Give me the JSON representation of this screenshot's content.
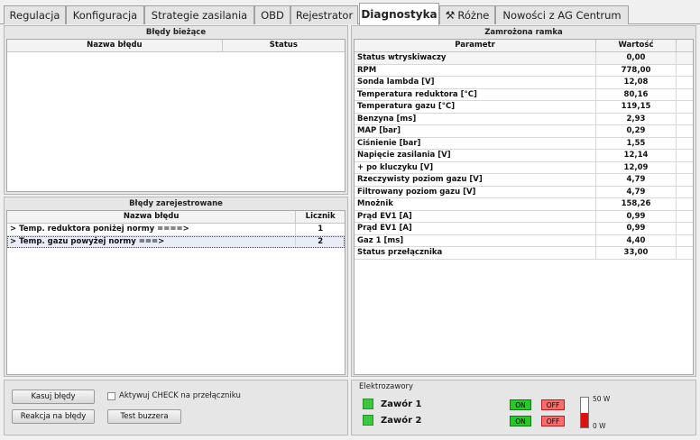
{
  "tabs": [
    {
      "label": "Regulacja"
    },
    {
      "label": "Konfiguracja"
    },
    {
      "label": "Strategie zasilania"
    },
    {
      "label": "OBD"
    },
    {
      "label": "Rejestrator"
    },
    {
      "label": "Diagnostyka",
      "active": true
    },
    {
      "label": "Różne",
      "icon": "tools-icon"
    },
    {
      "label": "Nowości z AG Centrum"
    }
  ],
  "current_errors": {
    "title": "Błędy bieżące",
    "columns": [
      "Nazwa błędu",
      "Status"
    ],
    "rows": []
  },
  "registered_errors": {
    "title": "Błędy zarejestrowane",
    "columns": [
      "Nazwa błędu",
      "Licznik"
    ],
    "rows": [
      {
        "name": "> Temp. reduktora poniżej normy ====>",
        "count": "1"
      },
      {
        "name": "> Temp. gazu powyżej normy ===>",
        "count": "2"
      }
    ]
  },
  "controls": {
    "clear_errors": "Kasuj błędy",
    "error_reaction": "Reakcja na błędy",
    "activate_check": "Aktywuj CHECK na przełączniku",
    "activate_check_checked": false,
    "buzzer_test": "Test buzzera"
  },
  "frozen_frame": {
    "title": "Zamrożona ramka",
    "columns": [
      "Parametr",
      "Wartość"
    ],
    "rows": [
      {
        "param": "Status wtryskiwaczy",
        "value": "0,00"
      },
      {
        "param": "RPM",
        "value": "778,00"
      },
      {
        "param": "Sonda lambda [V]",
        "value": "12,08"
      },
      {
        "param": "Temperatura reduktora [°C]",
        "value": "80,16"
      },
      {
        "param": "Temperatura gazu [°C]",
        "value": "119,15"
      },
      {
        "param": "Benzyna [ms]",
        "value": "2,93"
      },
      {
        "param": "MAP [bar]",
        "value": "0,29"
      },
      {
        "param": "Ciśnienie [bar]",
        "value": "1,55"
      },
      {
        "param": "Napięcie zasilania [V]",
        "value": "12,14"
      },
      {
        "param": "+ po kluczyku [V]",
        "value": "12,09"
      },
      {
        "param": "Rzeczywisty poziom gazu [V]",
        "value": "4,79"
      },
      {
        "param": "Filtrowany poziom gazu [V]",
        "value": "4,79"
      },
      {
        "param": "Mnożnik",
        "value": "158,26"
      },
      {
        "param": "Prąd EV1 [A]",
        "value": "0,99"
      },
      {
        "param": "Prąd EV1 [A]",
        "value": "0,99"
      },
      {
        "param": "Gaz 1 [ms]",
        "value": "4,40"
      },
      {
        "param": "Status przełącznika",
        "value": "33,00"
      }
    ]
  },
  "valves": {
    "title": "Elektrozawory",
    "items": [
      {
        "name": "Zawór 1",
        "on": "ON",
        "off": "OFF"
      },
      {
        "name": "Zawór 2",
        "on": "ON",
        "off": "OFF"
      }
    ],
    "gauge_max_label": "50 W",
    "gauge_min_label": "0 W",
    "gauge_level_percent": 50,
    "colors": {
      "on": "#28c828",
      "off": "#ff6a6a",
      "gauge": "#e01010",
      "led": "#3cc83c"
    }
  }
}
